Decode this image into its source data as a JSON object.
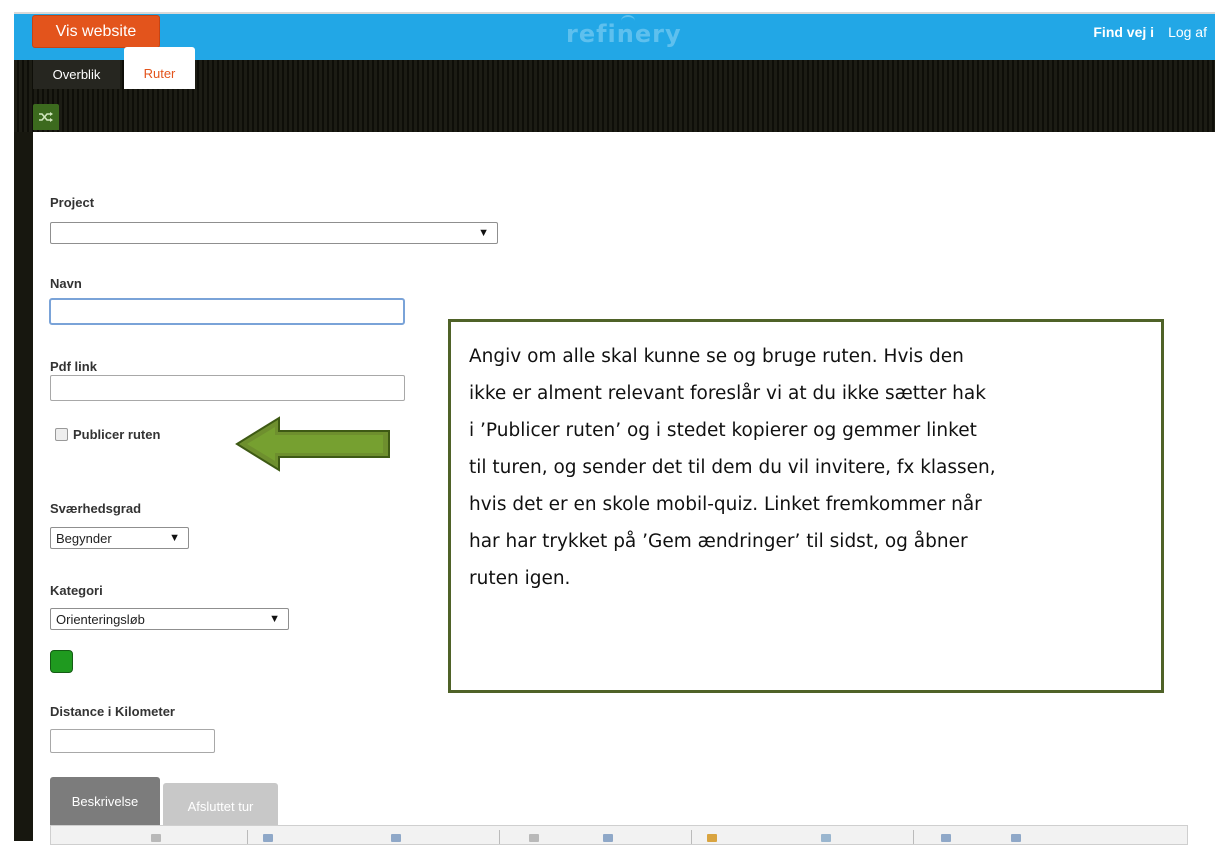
{
  "header": {
    "vis_website": "Vis website",
    "logo": "refinery",
    "find_vej": "Find vej i",
    "log_af": "Log af"
  },
  "nav": {
    "tabs": [
      {
        "label": "Overblik",
        "active": false
      },
      {
        "label": "Ruter",
        "active": true
      }
    ],
    "shuffle_icon": "shuffle-icon"
  },
  "form": {
    "project_label": "Project",
    "project_value": "",
    "navn_label": "Navn",
    "navn_value": "",
    "pdf_label": "Pdf link",
    "pdf_value": "",
    "publish_label": "Publicer ruten",
    "publish_checked": false,
    "difficulty_label": "Sværhedsgrad",
    "difficulty_value": "Begynder",
    "category_label": "Kategori",
    "category_value": "Orienteringsløb",
    "category_color": "#1f9a1f",
    "distance_label": "Distance i Kilometer",
    "distance_value": ""
  },
  "callout": {
    "lines": [
      "Angiv om alle skal kunne se og bruge ruten. Hvis den",
      "ikke er alment relevant foreslår vi at du ikke sætter hak",
      "i ’Publicer ruten’ og i stedet kopierer og gemmer linket",
      "til turen, og sender det til dem du vil invitere, fx klassen,",
      "hvis det er en skole mobil-quiz. Linket fremkommer når",
      "har har trykket på ’Gem ændringer’ til sidst, og åbner",
      "ruten igen."
    ],
    "border_color": "#4f6228",
    "arrow_color": "#6e8f2e"
  },
  "bottom_tabs": [
    {
      "label": "Beskrivelse",
      "active": true
    },
    {
      "label": "Afsluttet tur",
      "active": false
    }
  ]
}
